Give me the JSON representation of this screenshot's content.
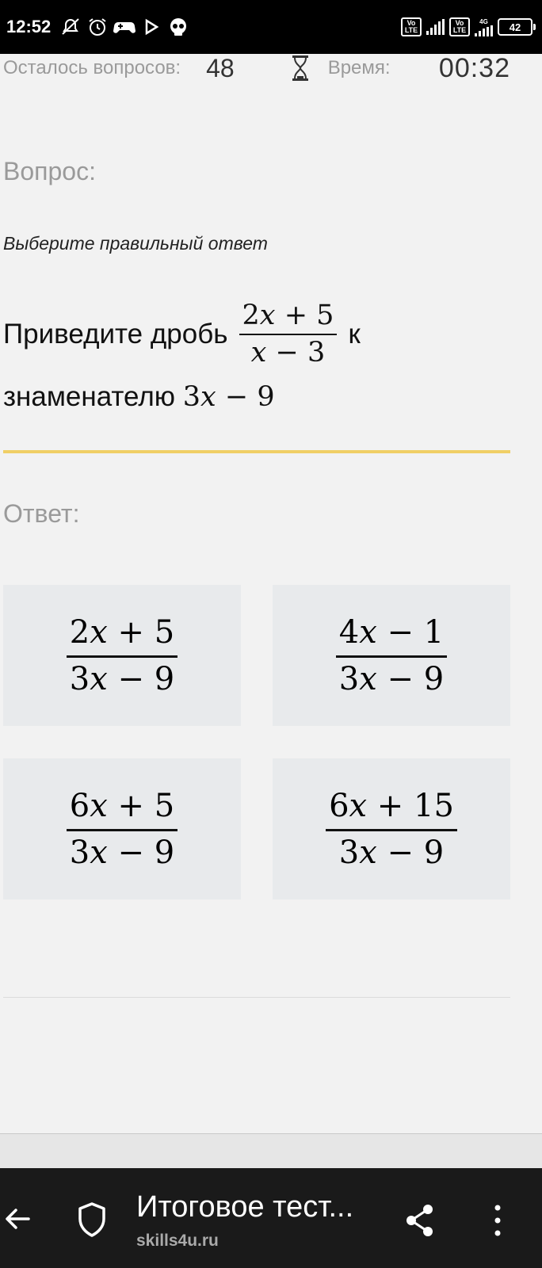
{
  "status_bar": {
    "time": "12:52",
    "battery": "42",
    "volte_label": "Vo LTE",
    "network": "4G"
  },
  "quiz": {
    "remaining_label": "Осталось вопросов:",
    "remaining_count": "48",
    "time_label": "Время:",
    "time_value": "00:32",
    "question_heading": "Вопрос:",
    "instruction": "Выберите правильный ответ",
    "question": {
      "prefix": "Приведите дробь",
      "fraction": {
        "num": "2x + 5",
        "den": "x − 3"
      },
      "suffix": "к",
      "line2_text": "знаменателю",
      "line2_math": "3x − 9"
    },
    "answer_heading": "Ответ:",
    "options": [
      {
        "num": "2x + 5",
        "den": "3x − 9"
      },
      {
        "num": "4x − 1",
        "den": "3x − 9"
      },
      {
        "num": "6x + 5",
        "den": "3x − 9"
      },
      {
        "num": "6x + 15",
        "den": "3x − 9"
      }
    ]
  },
  "browser": {
    "page_title": "Итоговое тест...",
    "domain": "skills4u.ru"
  },
  "colors": {
    "accent_yellow": "#f0cf66",
    "option_bg": "#e8eaec",
    "page_bg": "#f2f2f2",
    "browser_bar_bg": "#1a1a1a"
  }
}
